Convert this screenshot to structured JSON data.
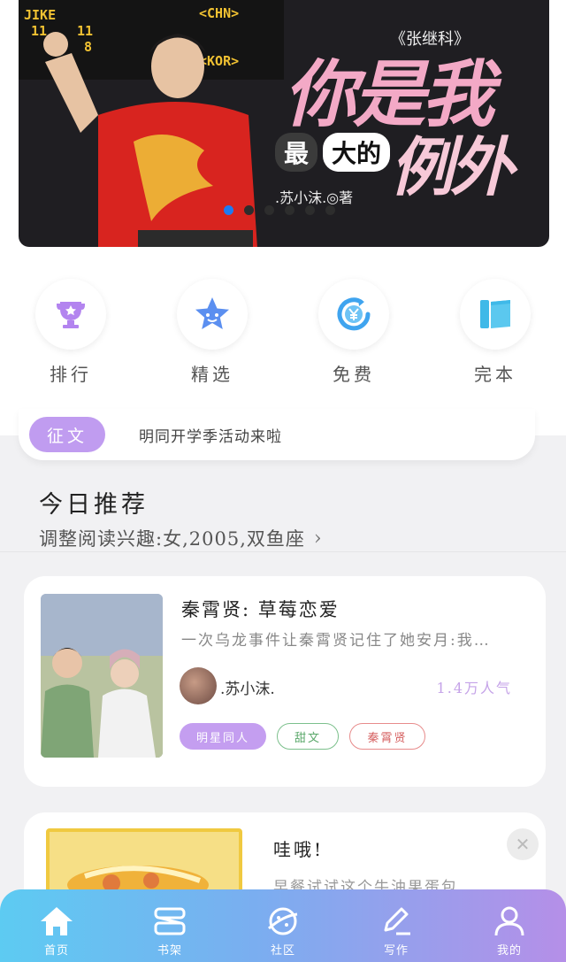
{
  "banner": {
    "score_texts": [
      "JIKE",
      "11",
      "11",
      "8",
      "<CHN>",
      "<KOR>"
    ],
    "subtitle": "《张继科》",
    "title_line1": "你是我",
    "title_chip1": "最",
    "title_chip2": "大的",
    "title_line2": "例外",
    "author": ".苏小沫.◎著",
    "dots_total": 6,
    "active_dot": 0
  },
  "categories": [
    {
      "label": "排行",
      "icon": "trophy-icon"
    },
    {
      "label": "精选",
      "icon": "star-icon"
    },
    {
      "label": "免费",
      "icon": "yen-refresh-icon"
    },
    {
      "label": "完本",
      "icon": "book-icon"
    }
  ],
  "notice": {
    "tag": "征文",
    "text": "明同开学季活动来啦"
  },
  "today": {
    "title": "今日推荐",
    "subtitle": "调整阅读兴趣:女,2005,双鱼座",
    "chevron": "›"
  },
  "book": {
    "title": "秦霄贤: 草莓恋爱",
    "description": "一次乌龙事件让秦霄贤记住了她安月:我…",
    "author": ".苏小沫.",
    "popularity": "1.4万人气",
    "tags": [
      "明星同人",
      "甜文",
      "秦霄贤"
    ]
  },
  "promo": {
    "title": "哇哦!",
    "description": "早餐试试这个牛油果蛋包",
    "close_icon": "close-icon"
  },
  "tabbar": [
    {
      "label": "首页",
      "icon": "home-icon"
    },
    {
      "label": "书架",
      "icon": "bookshelf-icon"
    },
    {
      "label": "社区",
      "icon": "planet-icon"
    },
    {
      "label": "写作",
      "icon": "pen-icon"
    },
    {
      "label": "我的",
      "icon": "user-icon"
    }
  ],
  "colors": {
    "accent_purple": "#c09cf0",
    "active_dot": "#1e7bf2",
    "tabbar_start": "#5dcbf2",
    "tabbar_end": "#b58fe8",
    "popularity": "#c5a3e8"
  }
}
